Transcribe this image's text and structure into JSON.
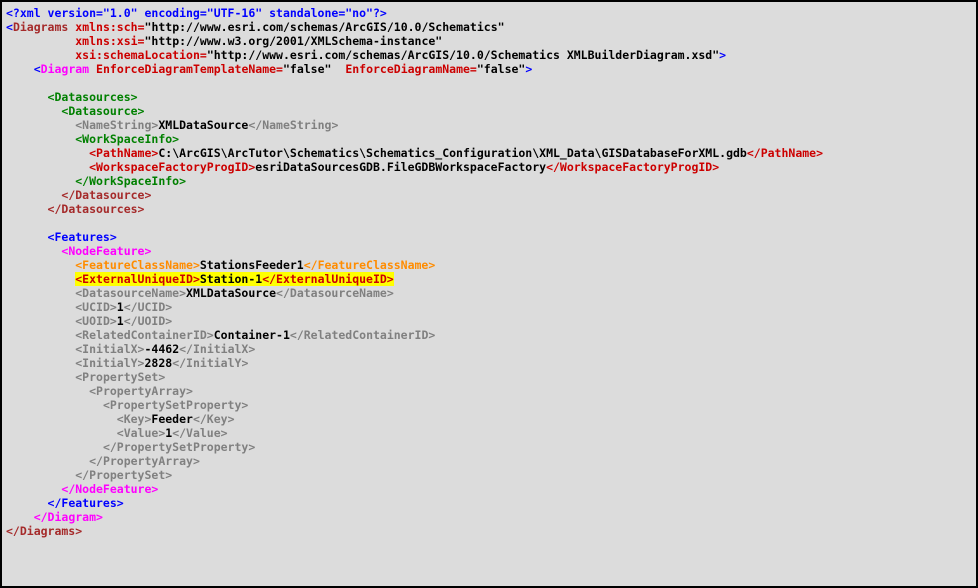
{
  "xml_decl": "<?xml version=\"1.0\" encoding=\"UTF-16\" standalone=\"no\"?>",
  "root_open": "Diagrams",
  "ns": {
    "sch": "xmlns:sch=",
    "sch_val": "\"http://www.esri.com/schemas/ArcGIS/10.0/Schematics\"",
    "xsi": "xmlns:xsi=",
    "xsi_val": "\"http://www.w3.org/2001/XMLSchema-instance\"",
    "loc": "xsi:schemaLocation=",
    "loc_val": "\"http://www.esri.com/schemas/ArcGIS/10.0/Schematics XMLBuilderDiagram.xsd\""
  },
  "diagram": {
    "tag": "Diagram",
    "attr1": "EnforceDiagramTemplateName=",
    "attr1v": "\"false\"",
    "attr2": "EnforceDiagramName=",
    "attr2v": "\"false\""
  },
  "ds": {
    "open": "<Datasources>",
    "close": "</Datasources>",
    "item_open": "<Datasource>",
    "item_close": "</Datasource>",
    "name_o": "<NameString>",
    "name_v": "XMLDataSource",
    "name_c": "</NameString>",
    "ws_o": "<WorkSpaceInfo>",
    "ws_c": "</WorkSpaceInfo>",
    "path_o": "<PathName>",
    "path_v": "C:\\ArcGIS\\ArcTutor\\Schematics\\Schematics_Configuration\\XML_Data\\GISDatabaseForXML.gdb",
    "path_c": "</PathName>",
    "wfp_o": "<WorkspaceFactoryProgID>",
    "wfp_v": "esriDataSourcesGDB.FileGDBWorkspaceFactory",
    "wfp_c": "</WorkspaceFactoryProgID>"
  },
  "ft": {
    "open": "<Features>",
    "close": "</Features>",
    "nf_o": "<NodeFeature>",
    "nf_c": "</NodeFeature>",
    "fcn_o": "<FeatureClassName>",
    "fcn_v": "StationsFeeder1",
    "fcn_c": "</FeatureClassName>",
    "eu_o": "<ExternalUniqueID>",
    "eu_v": "Station-1",
    "eu_c": "</ExternalUniqueID>",
    "dsn_o": "<DatasourceName>",
    "dsn_v": "XMLDataSource",
    "dsn_c": "</DatasourceName>",
    "ucid_o": "<UCID>",
    "ucid_v": "1",
    "ucid_c": "</UCID>",
    "uoid_o": "<UOID>",
    "uoid_v": "1",
    "uoid_c": "</UOID>",
    "rcid_o": "<RelatedContainerID>",
    "rcid_v": "Container-1",
    "rcid_c": "</RelatedContainerID>",
    "ix_o": "<InitialX>",
    "ix_v": "-4462",
    "ix_c": "</InitialX>",
    "iy_o": "<InitialY>",
    "iy_v": "2828",
    "iy_c": "</InitialY>",
    "ps_o": "<PropertySet>",
    "ps_c": "</PropertySet>",
    "pa_o": "<PropertyArray>",
    "pa_c": "</PropertyArray>",
    "psp_o": "<PropertySetProperty>",
    "psp_c": "</PropertySetProperty>",
    "k_o": "<Key>",
    "k_v": "Feeder",
    "k_c": "</Key>",
    "v_o": "<Value>",
    "v_v": "1",
    "v_c": "</Value>"
  },
  "diagram_close": "</Diagram>",
  "root_close": "</Diagrams>"
}
